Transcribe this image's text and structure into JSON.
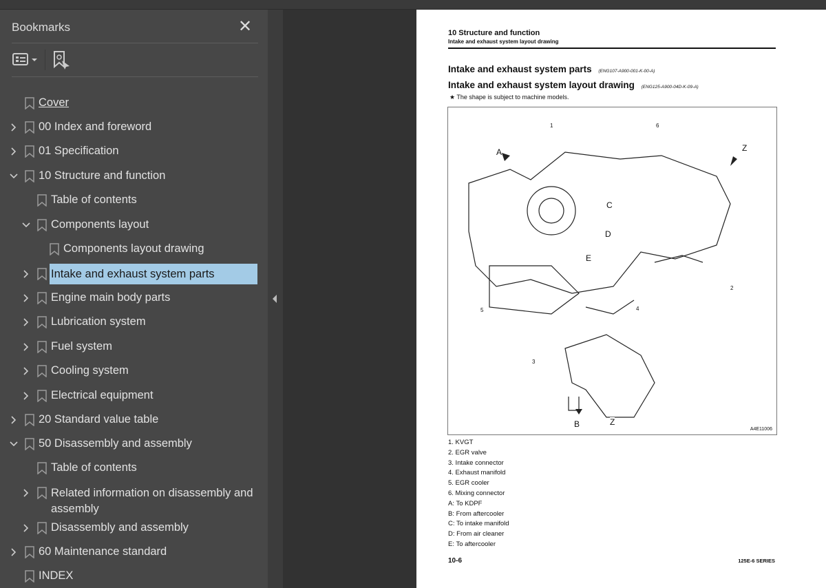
{
  "sidebar": {
    "title": "Bookmarks",
    "close": "✕",
    "items": [
      {
        "label": "Cover",
        "level": 0,
        "state": "none",
        "link": true
      },
      {
        "label": "00 Index and foreword",
        "level": 0,
        "state": "collapsed"
      },
      {
        "label": "01 Specification",
        "level": 0,
        "state": "collapsed"
      },
      {
        "label": "10 Structure and function",
        "level": 0,
        "state": "expanded"
      },
      {
        "label": "Table of contents",
        "level": 1,
        "state": "none"
      },
      {
        "label": "Components layout",
        "level": 1,
        "state": "expanded"
      },
      {
        "label": "Components layout drawing",
        "level": 2,
        "state": "none"
      },
      {
        "label": "Intake and exhaust system parts",
        "level": 1,
        "state": "collapsed",
        "selected": true
      },
      {
        "label": "Engine main body parts",
        "level": 1,
        "state": "collapsed"
      },
      {
        "label": "Lubrication system",
        "level": 1,
        "state": "collapsed"
      },
      {
        "label": "Fuel system",
        "level": 1,
        "state": "collapsed"
      },
      {
        "label": "Cooling system",
        "level": 1,
        "state": "collapsed"
      },
      {
        "label": "Electrical equipment",
        "level": 1,
        "state": "collapsed"
      },
      {
        "label": "20 Standard value table",
        "level": 0,
        "state": "collapsed"
      },
      {
        "label": "50 Disassembly and assembly",
        "level": 0,
        "state": "expanded"
      },
      {
        "label": "Table of contents",
        "level": 1,
        "state": "none"
      },
      {
        "label": "Related information on disassembly and assembly",
        "level": 1,
        "state": "collapsed",
        "multiline": true
      },
      {
        "label": "Disassembly and assembly",
        "level": 1,
        "state": "collapsed"
      },
      {
        "label": "60 Maintenance standard",
        "level": 0,
        "state": "collapsed"
      },
      {
        "label": "INDEX",
        "level": 0,
        "state": "none"
      }
    ]
  },
  "page": {
    "header_section": "10 Structure and function",
    "header_sub": "Intake and exhaust system layout drawing",
    "h1": "Intake and exhaust system parts",
    "h1_code": "(ENG107-A900-001-K-00-A)",
    "h2": "Intake and exhaust system layout drawing",
    "h2_code": "(ENG125-A900-04D-K-09-A)",
    "note": "★  The shape is subject to machine models.",
    "figure": {
      "id": "A4E11006",
      "callouts": [
        "1",
        "6",
        "A",
        "Z",
        "C",
        "D",
        "E",
        "2",
        "5",
        "4",
        "3",
        "B",
        "Z"
      ]
    },
    "legend": [
      "1. KVGT",
      "2. EGR valve",
      "3. Intake connector",
      "4. Exhaust manifold",
      "5. EGR cooler",
      "6. Mixing connector",
      "A: To KDPF",
      "B: From aftercooler",
      "C: To intake manifold",
      "D: From air cleaner",
      "E: To aftercooler"
    ],
    "page_number": "10-6",
    "series": "125E-6 SERIES"
  }
}
